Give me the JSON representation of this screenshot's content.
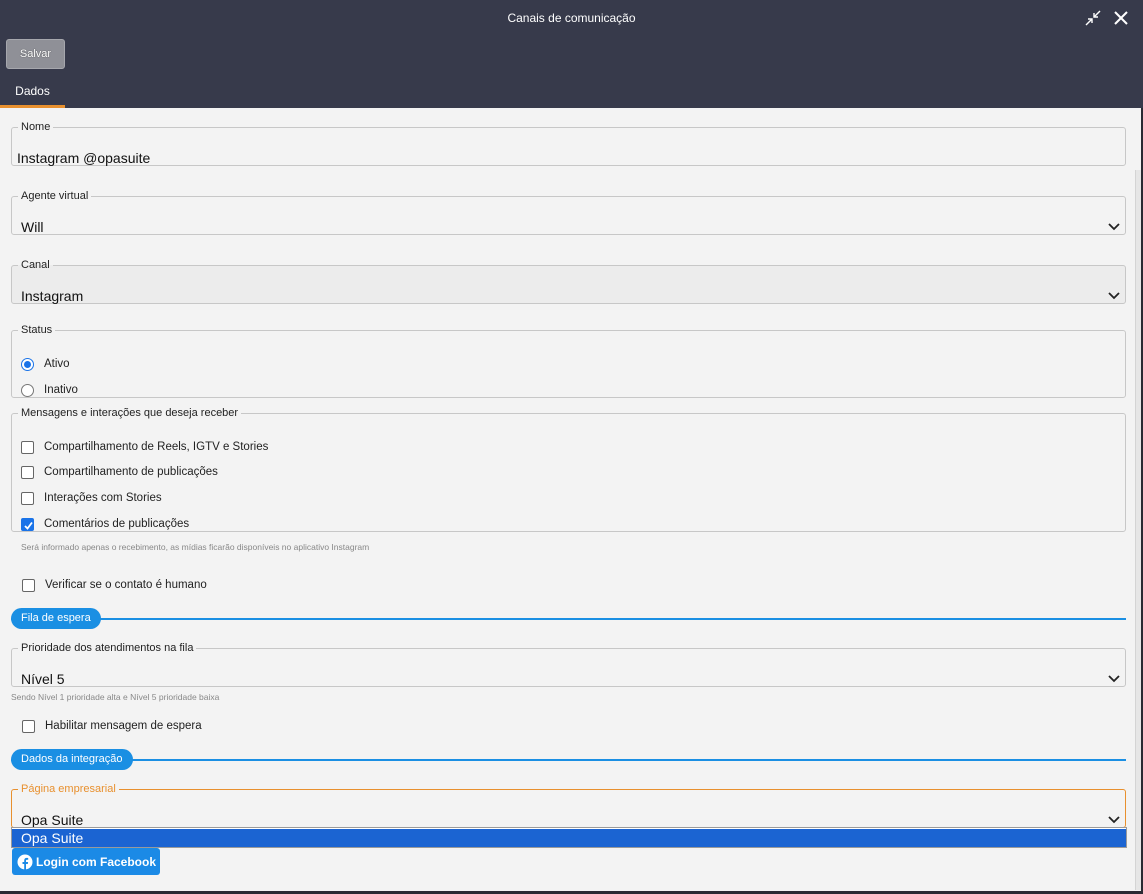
{
  "window": {
    "title": "Canais de comunicação",
    "save_label": "Salvar",
    "tab_label": "Dados"
  },
  "fields": {
    "nome": {
      "label": "Nome",
      "value": "Instagram @opasuite"
    },
    "agente": {
      "label": "Agente virtual",
      "value": "Will"
    },
    "canal": {
      "label": "Canal",
      "value": "Instagram"
    },
    "status": {
      "label": "Status",
      "options": [
        {
          "label": "Ativo",
          "selected": true
        },
        {
          "label": "Inativo",
          "selected": false
        }
      ]
    },
    "mensagens": {
      "label": "Mensagens e interações que deseja receber",
      "options": [
        {
          "label": "Compartilhamento de Reels, IGTV e Stories",
          "checked": false
        },
        {
          "label": "Compartilhamento de publicações",
          "checked": false
        },
        {
          "label": "Interações com Stories",
          "checked": false
        },
        {
          "label": "Comentários de publicações",
          "checked": true
        }
      ],
      "hint": "Será informado apenas o recebimento, as mídias ficarão disponíveis no aplicativo Instagram"
    },
    "verificar_humano": {
      "label": "Verificar se o contato é humano",
      "checked": false
    }
  },
  "fila": {
    "section_label": "Fila de espera",
    "prioridade": {
      "label": "Prioridade dos atendimentos na fila",
      "value": "Nível 5"
    },
    "hint": "Sendo Nível 1 prioridade alta e Nível 5 prioridade baixa",
    "mensagem_espera": {
      "label": "Habilitar mensagem de espera",
      "checked": false
    }
  },
  "integracao": {
    "section_label": "Dados da integração",
    "pagina": {
      "label": "Página empresarial",
      "value": "Opa Suite"
    },
    "dropdown_options": [
      "Opa Suite"
    ],
    "facebook_button": "Login com Facebook"
  },
  "colors": {
    "header": "#373a4b",
    "accent_orange": "#e8902e",
    "accent_blue": "#1a8fe3",
    "selected_option": "#1b64d2"
  },
  "icons": [
    "minimize-icon",
    "close-icon",
    "chevron-down-icon",
    "facebook-icon",
    "check-icon"
  ]
}
